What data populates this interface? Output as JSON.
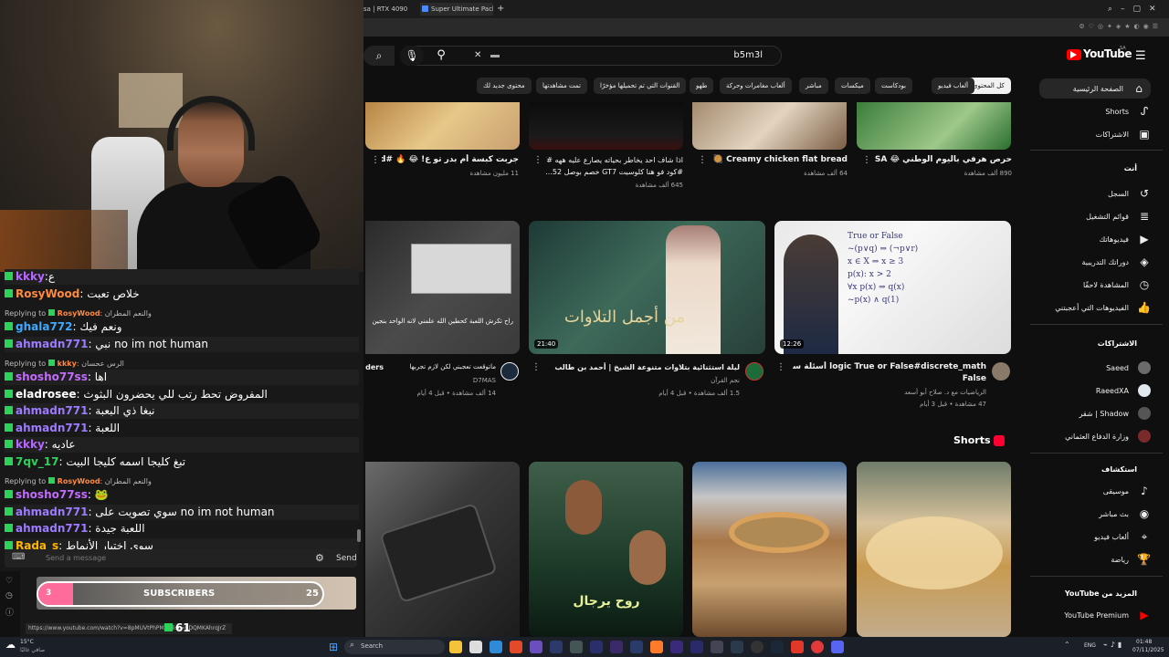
{
  "tabs": [
    {
      "label": "sa | RTX 4090"
    },
    {
      "label": "Super Ultimate Pack | Mix"
    }
  ],
  "youtube": {
    "logo_text": "YouTube",
    "region": "SA",
    "search_query": "b5m3l",
    "chips": [
      "كل المحتوى",
      "ألعاب فيديو",
      "بودكاست",
      "ميكسات",
      "مباشر",
      "ألعاب مغامرات وحركة",
      "طهو",
      "القنوات التي تم تحميلها مؤخرًا",
      "تمت مشاهدتها",
      "محتوى جديد لك"
    ],
    "row1": [
      {
        "title": "حرص هرفي باليوم الوطني 😂 SA",
        "meta": "890 ألف مشاهدة"
      },
      {
        "title": "Creamy chicken flat bread 🥘",
        "meta": "64 ألف مشاهدة"
      },
      {
        "title": "اذا شاف احد يخاطر بحياته يصارع عليه ههه #كود فو هنا كلوسيت GT7 خصم بوصل 52...",
        "title2": "#كود فو هنا كلوسيت GT7 خصم بوصل 52...",
        "meta": "645 ألف مشاهدة"
      },
      {
        "title": "جربت كبسة أم بدر تو ع! 😂 🔥 #ad",
        "meta": "11 مليون مشاهدة"
      }
    ],
    "row2": [
      {
        "title": "logic True or False#discrete_math أسئلة سنوات سابقة على",
        "title2": "False",
        "channel": "الرياضيات مع د. صلاح أبو أسعد",
        "meta": "47 مشاهدة • قبل 3 أيام",
        "duration": "12:26"
      },
      {
        "title": "ليلة استثنائية بتلاوات متنوعة  الشيخ | أحمد بن طالب",
        "channel": "نجم القرآن",
        "meta": "1.5 ألف مشاهدة • قبل 4 أيام",
        "duration": "21:40",
        "overlay": "من أجمل التلاوات"
      },
      {
        "title": "ماتوقعت تعجبني لكن لازم تجربها",
        "title_tail": "ders",
        "channel": "D7MAS",
        "meta": "14 ألف مشاهدة • قبل 4 أيام",
        "overlay": "راح تكرش اللعبة كحطين الله علمني لانه الواحد بنجين"
      }
    ],
    "shorts_label": "Shorts",
    "short_overlay": "روح يرجال",
    "sidebar": {
      "main": [
        "الصفحة الرئيسية",
        "Shorts",
        "الاشتراكات"
      ],
      "you_head": "أنت",
      "you": [
        "السجل",
        "قوائم التشغيل",
        "فيديوهاتك",
        "دوراتك التدريبية",
        "المشاهدة لاحقًا",
        "الفيديوهات التي أعجبتني"
      ],
      "subs_head": "الاشتراكات",
      "subs": [
        "Saeed",
        "RaeedXA",
        "Shadow | شقر",
        "وزارة الدفاع العثماني"
      ],
      "explore_head": "استكشاف",
      "explore": [
        "موسيقى",
        "بث مباشر",
        "ألعاب فيديو",
        "رياضة"
      ],
      "more_head": "المزيد من YouTube",
      "more": [
        "YouTube Premium"
      ]
    }
  },
  "chat": {
    "messages": [
      {
        "user": "kkky",
        "text": ":ع",
        "color": "#b667ff"
      },
      {
        "user": "RosyWood",
        "text": ": خلاص تعبت",
        "color": "#ff8a3d"
      },
      {
        "reply": "Replying to",
        "reply_user": "RosyWood",
        "reply_text": ": والنعم المطران"
      },
      {
        "user": "ghala772",
        "text": ": ونعم فيك",
        "color": "#3fa9ff"
      },
      {
        "user": "ahmadn771",
        "text": ": نبي no im not human",
        "color": "#9d7bff"
      },
      {
        "reply": "Replying to",
        "reply_user": "kkky",
        "reply_text": ": الرس عحسان"
      },
      {
        "user": "shosho77ss",
        "text": ": اها",
        "color": "#c36bff"
      },
      {
        "user": "eladrosee",
        "text": ": المفروض تحط رتب للي يحضرون البثوث",
        "color": "#ffffff"
      },
      {
        "user": "ahmadn771",
        "text": ": نبغا ذي البعبة",
        "color": "#9d7bff"
      },
      {
        "user": "ahmadn771",
        "text": ": اللعبة",
        "color": "#9d7bff"
      },
      {
        "user": "kkky",
        "text": ": عاديه",
        "color": "#b667ff"
      },
      {
        "user": "7qv_17",
        "text": ": تبغ كليجا اسمه كليجا البيت",
        "color": "#2ed15a"
      },
      {
        "reply": "Replying to",
        "reply_user": "RosyWood",
        "reply_text": ": والنعم المطران"
      },
      {
        "user": "shosho77ss",
        "text": ": 🐸",
        "color": "#c36bff"
      },
      {
        "user": "ahmadn771",
        "text": ": سوي تصويت على no im not human",
        "color": "#9d7bff"
      },
      {
        "user": "ahmadn771",
        "text": ": اللعبة جيدة",
        "color": "#9d7bff"
      },
      {
        "user": "Rada_s",
        "text": ": سوي اختيار الأنماط",
        "color": "#ffb400"
      }
    ],
    "input_placeholder": "Send a message",
    "send_label": "Send",
    "sub_goal": {
      "current": "3",
      "label": "SUBSCRIBERS",
      "target": "25"
    },
    "viewer_count": "61",
    "status_url": "https://www.youtube.com/watch?v=8pMUVtPhPMA&list=RDQMKAhrqJrZ"
  },
  "taskbar": {
    "weather": "15°C",
    "weather_sub": "صافي غالبًا",
    "search_placeholder": "Search",
    "lang": "ENG",
    "time": "01:48",
    "date": "07/11/2025"
  }
}
